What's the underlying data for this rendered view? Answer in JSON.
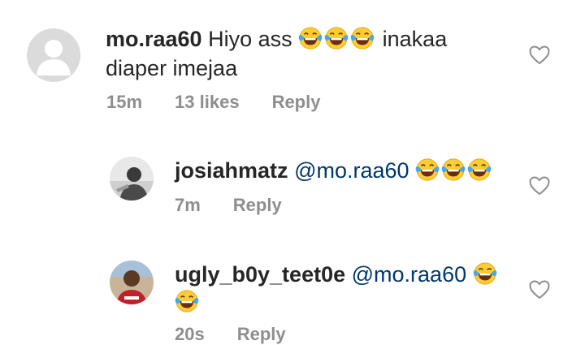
{
  "comments": [
    {
      "username": "mo.raa60",
      "text_line1": "Hiyo ass",
      "text_line1_after": "inakaa",
      "text_line2": "diaper imejaa",
      "time": "15m",
      "likes": "13 likes",
      "reply_label": "Reply",
      "avatar": "default-avatar-icon"
    },
    {
      "username": "josiahmatz",
      "mention": "@mo.raa60",
      "time": "7m",
      "reply_label": "Reply",
      "avatar": "user-photo-josiahmatz"
    },
    {
      "username": "ugly_b0y_teet0e",
      "mention": "@mo.raa60",
      "time": "20s",
      "reply_label": "Reply",
      "avatar": "user-photo-ugly_b0y_teet0e"
    }
  ],
  "icons": {
    "like": "heart-outline-icon",
    "emoji": "face-with-tears-of-joy-emoji"
  },
  "colors": {
    "text": "#262626",
    "mention": "#00376b",
    "meta": "#8e8e8e",
    "emoji_face": "#FFCC33",
    "emoji_tears": "#3FA9F5"
  }
}
